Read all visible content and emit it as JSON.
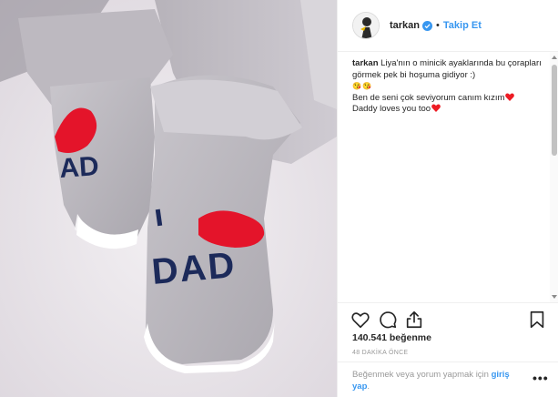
{
  "header": {
    "username": "tarkan",
    "follow_label": "Takip Et",
    "separator": "•"
  },
  "caption": {
    "username": "tarkan",
    "line1": "Liya'nın o minicik ayaklarında bu çorapları görmek pek bi hoşuma gidiyor :)",
    "faces": "😘😘",
    "line2": "Ben de seni çok seviyorum canım kızım",
    "line3": "Daddy loves you too"
  },
  "photo": {
    "sock_text_left": "AD",
    "sock_text_right": "DAD"
  },
  "actions": {
    "likes": "140.541 beğenme",
    "time": "48 DAKİKA ÖNCE",
    "login_prefix": "Beğenmek veya yorum yapmak için ",
    "login_link": "giriş yap",
    "login_suffix": ".",
    "more": "•••"
  },
  "colors": {
    "accent": "#3897f0",
    "heart": "#ed1c24",
    "text": "#262626",
    "muted": "#999999"
  },
  "icons": [
    "verified-badge-icon",
    "heart-icon",
    "comment-icon",
    "share-icon",
    "bookmark-icon",
    "more-icon"
  ]
}
